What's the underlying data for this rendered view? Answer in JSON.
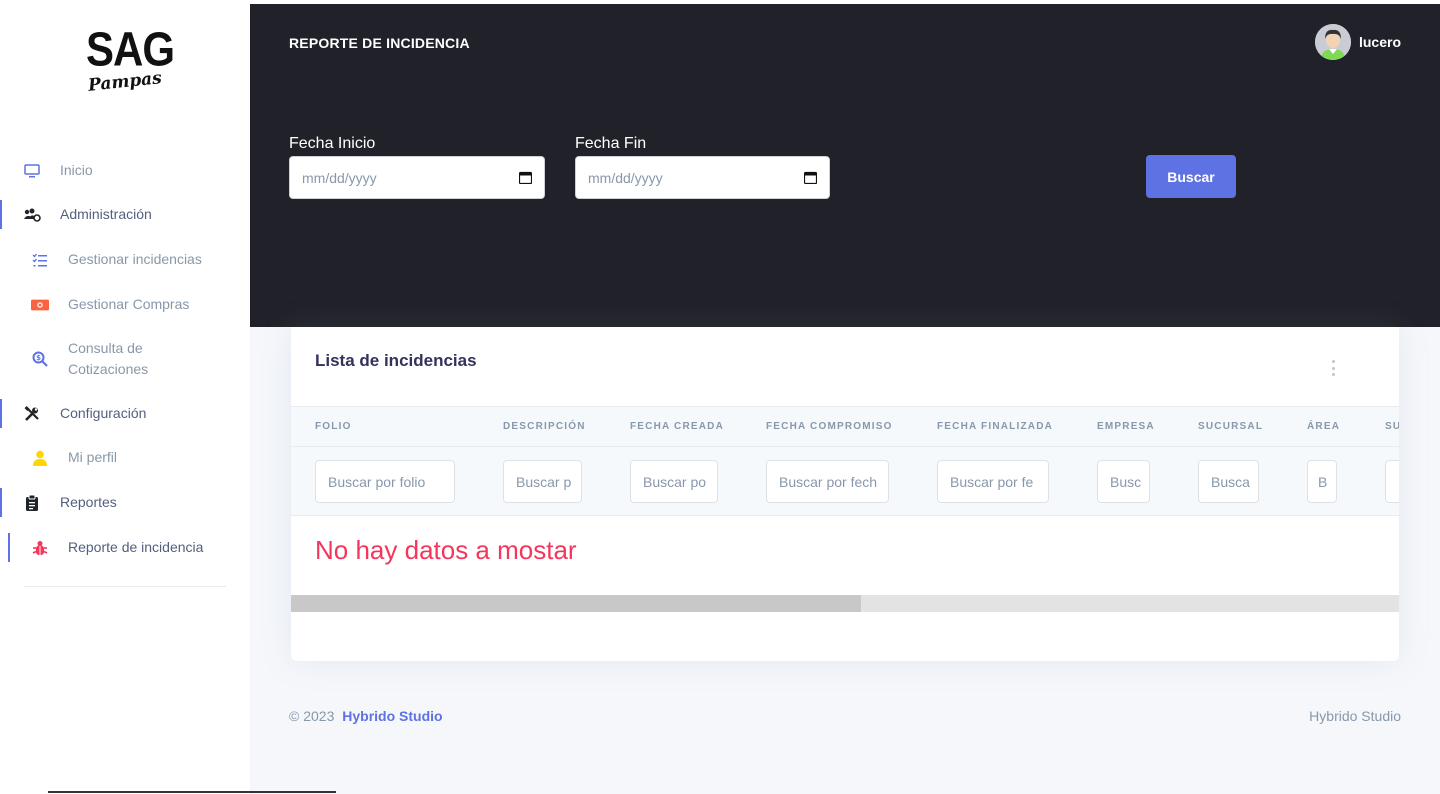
{
  "brand": {
    "logo_main": "SAG",
    "logo_sub": "Pampas"
  },
  "sidebar": {
    "items": [
      {
        "label": "Inicio",
        "icon": "monitor-icon",
        "color": "#5e72e4"
      },
      {
        "label": "Administración",
        "icon": "users-cog-icon",
        "color": "#212529"
      },
      {
        "label": "Gestionar incidencias",
        "icon": "list-check-icon",
        "color": "#5e72e4"
      },
      {
        "label": "Gestionar Compras",
        "icon": "money-bill-icon",
        "color": "#fb6340"
      },
      {
        "label": "Consulta de",
        "label2": "Cotizaciones",
        "icon": "search-dollar-icon",
        "color": "#5e72e4"
      },
      {
        "label": "Configuración",
        "icon": "tools-icon",
        "color": "#212529"
      },
      {
        "label": "Mi perfil",
        "icon": "user-icon",
        "color": "#ffd600"
      },
      {
        "label": "Reportes",
        "icon": "clipboard-icon",
        "color": "#212529"
      },
      {
        "label": "Reporte de incidencia",
        "icon": "bug-icon",
        "color": "#f5365c"
      }
    ]
  },
  "header": {
    "title": "REPORTE DE INCIDENCIA",
    "user_name": "lucero",
    "fecha_inicio_label": "Fecha Inicio",
    "fecha_inicio_placeholder": "mm/dd/yyyy",
    "fecha_fin_label": "Fecha Fin",
    "fecha_fin_placeholder": "mm/dd/yyyy",
    "buscar_label": "Buscar"
  },
  "card": {
    "title": "Lista de incidencias",
    "columns": [
      "FOLIO",
      "DESCRIPCIÓN",
      "FECHA CREADA",
      "FECHA COMPROMISO",
      "FECHA FINALIZADA",
      "EMPRESA",
      "SUCURSAL",
      "ÁREA",
      "SU"
    ],
    "filters": [
      "Buscar por folio",
      "Buscar p",
      "Buscar po",
      "Buscar por fech",
      "Buscar por fe",
      "Busc",
      "Busca",
      "B",
      ""
    ],
    "empty_message": "No hay datos a mostar"
  },
  "footer": {
    "copyright": "© 2023",
    "brand": "Hybrido Studio",
    "right": "Hybrido Studio"
  },
  "colors": {
    "primary": "#5e72e4",
    "danger": "#f5365c",
    "header_bg": "#212229"
  }
}
